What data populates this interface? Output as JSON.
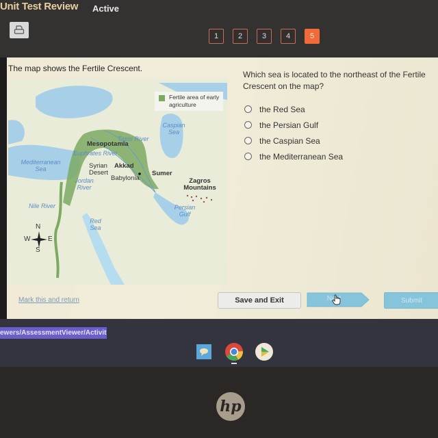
{
  "header": {
    "app_title": "Unit Test Review",
    "status": "Active",
    "print_icon": "printer-icon"
  },
  "question_nav": {
    "items": [
      "1",
      "2",
      "3",
      "4",
      "5"
    ],
    "active_index": 4,
    "active_color": "#f06a3a"
  },
  "prompt": "The map shows the Fertile Crescent.",
  "map": {
    "legend": "Fertile area of early agriculture",
    "legend_color": "#7daa63",
    "labels": {
      "caspian": "Caspian Sea",
      "tigris": "Tigris River",
      "mesopotamia": "Mesopotamia",
      "euphrates": "Euphrates River",
      "mediterranean": "Mediterranean Sea",
      "syrian": "Syrian Desert",
      "akkad": "Akkad",
      "sumer": "Sumer",
      "babylonia": "Babylonia",
      "jordan": "Jordan River",
      "zagros": "Zagros Mountains",
      "nile": "Nile River",
      "persian": "Persian Gulf",
      "red": "Red Sea"
    },
    "compass": {
      "n": "N",
      "s": "S",
      "e": "E",
      "w": "W"
    }
  },
  "question": {
    "text": "Which sea is located to the northeast of the Fertile Crescent on the map?",
    "options": [
      "the Red Sea",
      "the Persian Gulf",
      "the Caspian Sea",
      "the Mediterranean Sea"
    ],
    "selected": null
  },
  "footer": {
    "mark_link": "Mark this and return",
    "save_exit": "Save and Exit",
    "next": "Next",
    "submit": "Submit"
  },
  "taskbar": {
    "url": "ewers/AssessmentViewer/Activit...",
    "icons": [
      "chat-app-icon",
      "chrome-icon",
      "play-store-icon"
    ]
  },
  "device": {
    "logo": "hp"
  }
}
